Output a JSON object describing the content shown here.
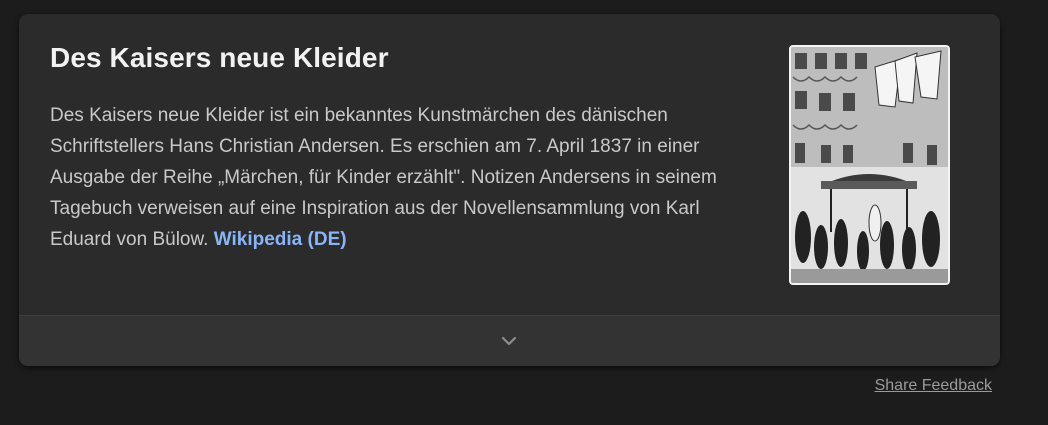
{
  "card": {
    "title": "Des Kaisers neue Kleider",
    "description": "Des Kaisers neue Kleider ist ein bekanntes Kunstmärchen des dänischen Schriftstellers Hans Christian Andersen. Es erschien am 7. April 1837 in einer Ausgabe der Reihe „Märchen, für Kinder erzählt\". Notizen Andersens in seinem Tagebuch verweisen auf eine Inspiration aus der Novellensammlung von Karl Eduard von Bülow.",
    "source_link": "Wikipedia (DE)",
    "image_icon": "illustration-thumbnail",
    "expand_icon": "chevron-down-icon"
  },
  "footer": {
    "share_feedback": "Share Feedback"
  },
  "colors": {
    "background": "#1c1c1c",
    "card": "#2b2b2b",
    "card_footer": "#333333",
    "title": "#f2f2f2",
    "body_text": "#c9c9c9",
    "link": "#8ab4f8",
    "muted": "#9a9a9a"
  }
}
